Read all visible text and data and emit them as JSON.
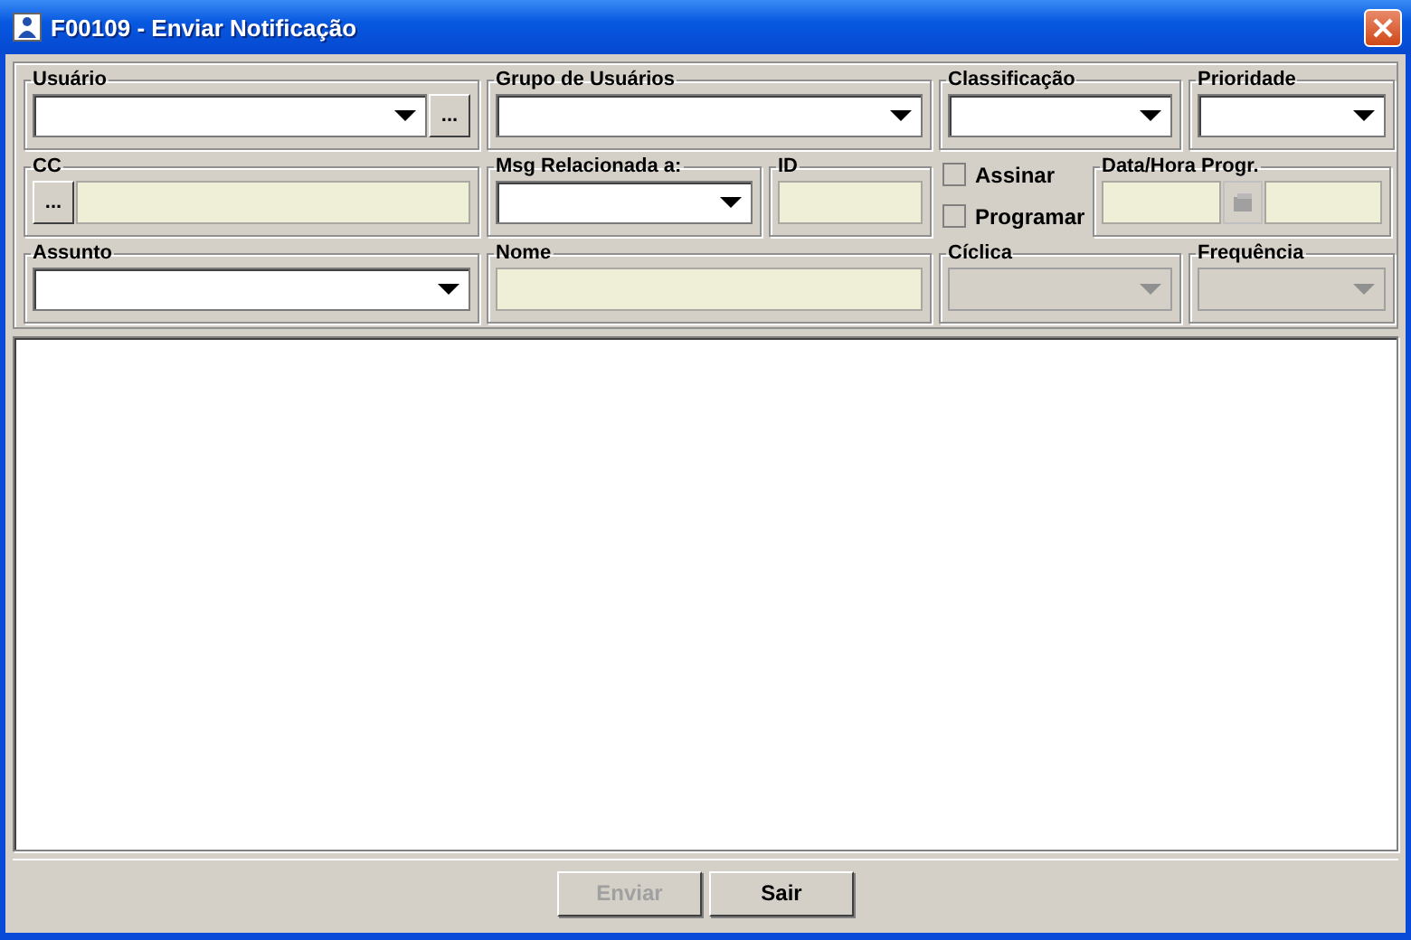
{
  "window": {
    "title": "F00109 - Enviar Notificação"
  },
  "form_rows": [
    [
      {
        "label": "Usuário",
        "kind": "lookup-combo",
        "button_label": "...",
        "disabled": false
      },
      {
        "label": "Grupo de Usuários",
        "kind": "combo",
        "disabled": false
      },
      {
        "label": "Classificação",
        "kind": "combo",
        "disabled": false
      },
      {
        "label": "Prioridade",
        "kind": "combo",
        "disabled": false
      }
    ],
    [
      {
        "label": "CC",
        "kind": "lookup-text",
        "button_label": "..."
      },
      {
        "label": "Msg Relacionada a:",
        "kind": "combo",
        "disabled": false
      },
      {
        "label": "ID",
        "kind": "text"
      },
      {
        "kind": "checks",
        "items": [
          {
            "label": "Assinar",
            "checked": false
          },
          {
            "label": "Programar",
            "checked": false
          }
        ]
      },
      {
        "label": "Data/Hora Progr.",
        "kind": "datetime"
      }
    ],
    [
      {
        "label": "Assunto",
        "kind": "combo",
        "disabled": false
      },
      {
        "label": "Nome",
        "kind": "text"
      },
      {
        "label": "Cíclica",
        "kind": "combo",
        "disabled": true
      },
      {
        "label": "Frequência",
        "kind": "combo",
        "disabled": true
      }
    ]
  ],
  "buttons": [
    {
      "label": "Enviar",
      "disabled": true
    },
    {
      "label": "Sair",
      "disabled": false
    }
  ]
}
